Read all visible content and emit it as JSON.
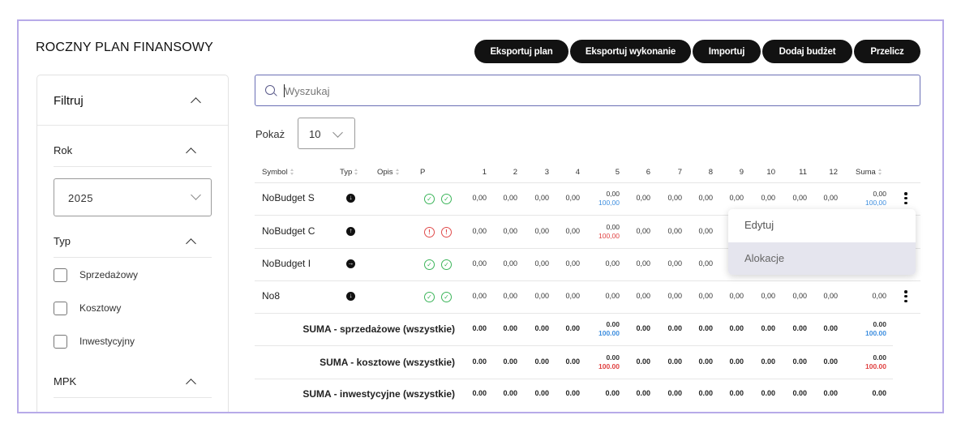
{
  "page": {
    "title": "ROCZNY PLAN FINANSOWY"
  },
  "toolbar": {
    "export_plan": "Eksportuj plan",
    "export_execution": "Eksportuj wykonanie",
    "import": "Importuj",
    "add_budget": "Dodaj budżet",
    "recalc": "Przelicz"
  },
  "filters": {
    "title": "Filtruj",
    "year_label": "Rok",
    "year_value": "2025",
    "type_label": "Typ",
    "types": [
      "Sprzedażowy",
      "Kosztowy",
      "Inwestycyjny"
    ],
    "mpk_label": "MPK"
  },
  "search": {
    "placeholder": "Wyszukaj",
    "value": ""
  },
  "pagination": {
    "show_label": "Pokaż",
    "show_value": "10"
  },
  "table": {
    "headers": {
      "symbol": "Symbol",
      "type": "Typ",
      "desc": "Opis",
      "p": "P",
      "months": [
        "1",
        "2",
        "3",
        "4",
        "5",
        "6",
        "7",
        "8",
        "9",
        "10",
        "11",
        "12"
      ],
      "sum": "Suma"
    },
    "rows": [
      {
        "symbol": "NoBudget S",
        "type_icon": "arrow-down-circle-icon",
        "status": "ok",
        "values": [
          "0,00",
          "0,00",
          "0,00",
          "0,00",
          "0,00",
          "0,00",
          "0,00",
          "0,00",
          "0,00",
          "0,00",
          "0,00",
          "0,00"
        ],
        "m5_sub": "100,00",
        "m5_sub_color": "#3d8edf",
        "sum": "0,00",
        "sum_sub": "100,00",
        "sum_sub_color": "#3d8edf"
      },
      {
        "symbol": "NoBudget C",
        "type_icon": "arrow-up-circle-icon",
        "status": "error",
        "values": [
          "0,00",
          "0,00",
          "0,00",
          "0,00",
          "0,00",
          "0,00",
          "0,00",
          "0,00",
          "",
          "",
          "",
          ""
        ],
        "m5_sub": "100,00",
        "m5_sub_color": "#e04040"
      },
      {
        "symbol": "NoBudget I",
        "type_icon": "arrow-right-circle-icon",
        "status": "ok",
        "values": [
          "0,00",
          "0,00",
          "0,00",
          "0,00",
          "0,00",
          "0,00",
          "0,00",
          "0,00",
          "",
          "",
          "",
          ""
        ]
      },
      {
        "symbol": "No8",
        "type_icon": "arrow-down-circle-icon",
        "status": "ok",
        "values": [
          "0,00",
          "0,00",
          "0,00",
          "0,00",
          "0,00",
          "0,00",
          "0,00",
          "0,00",
          "0,00",
          "0,00",
          "0,00",
          "0,00"
        ],
        "sum": "0,00"
      }
    ],
    "summaries": [
      {
        "label": "SUMA - sprzedażowe (wszystkie)",
        "values": [
          "0.00",
          "0.00",
          "0.00",
          "0.00",
          "0.00",
          "0.00",
          "0.00",
          "0.00",
          "0.00",
          "0.00",
          "0.00",
          "0.00"
        ],
        "m5_sub": "100.00",
        "m5_sub_color": "#3d8edf",
        "sum": "0.00",
        "sum_sub": "100.00",
        "sum_sub_color": "#3d8edf"
      },
      {
        "label": "SUMA - kosztowe (wszystkie)",
        "values": [
          "0.00",
          "0.00",
          "0.00",
          "0.00",
          "0.00",
          "0.00",
          "0.00",
          "0.00",
          "0.00",
          "0.00",
          "0.00",
          "0.00"
        ],
        "m5_sub": "100.00",
        "m5_sub_color": "#e04040",
        "sum": "0.00",
        "sum_sub": "100.00",
        "sum_sub_color": "#e04040"
      },
      {
        "label": "SUMA - inwestycyjne (wszystkie)",
        "values": [
          "0.00",
          "0.00",
          "0.00",
          "0.00",
          "0.00",
          "0.00",
          "0.00",
          "0.00",
          "0.00",
          "0.00",
          "0.00",
          "0.00"
        ],
        "sum": "0.00"
      }
    ]
  },
  "context_menu": {
    "edit": "Edytuj",
    "allocations": "Alokacje"
  },
  "colors": {
    "accent_border": "#b7aae8",
    "search_border": "#6a6fb5",
    "ok": "#3cb55a",
    "error": "#e04b4b",
    "button_bg": "#121212"
  }
}
